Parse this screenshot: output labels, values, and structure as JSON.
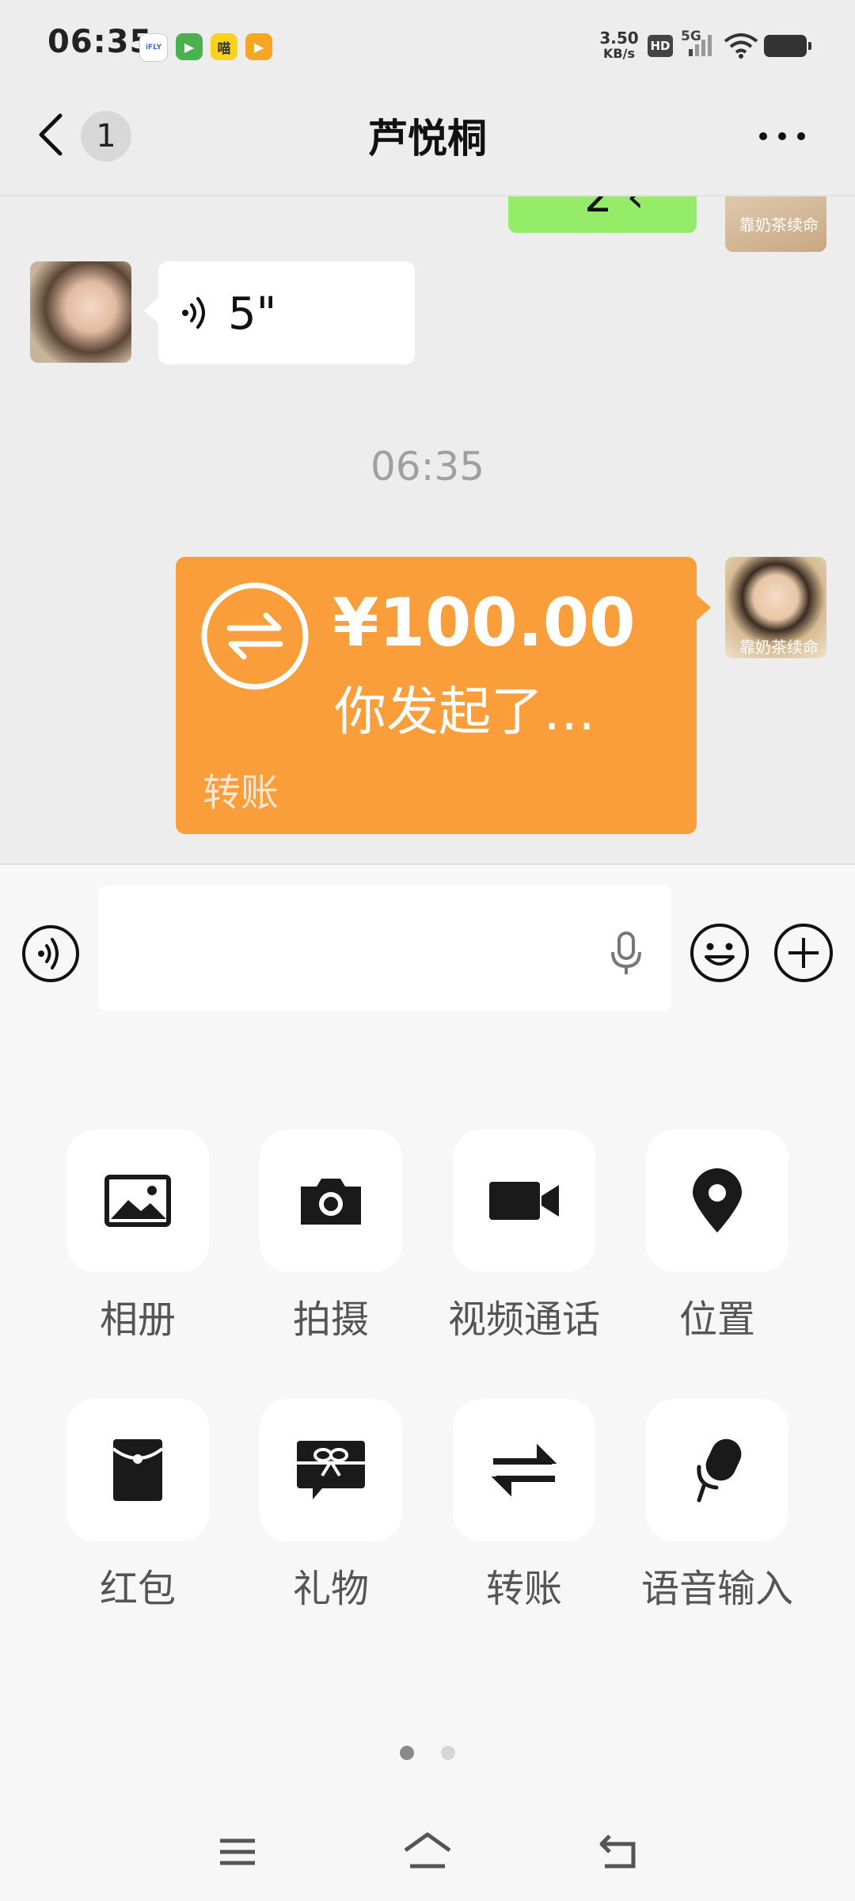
{
  "status_bar": {
    "time": "06:35",
    "net_speed_value": "3.50",
    "net_speed_unit": "KB/s",
    "hd_badge": "HD",
    "network": "5G",
    "app_badges": [
      {
        "name": "iflytek-app-icon",
        "color": "#ffffff",
        "text": "iFLY"
      },
      {
        "name": "video-app-icon",
        "color": "#4caf50",
        "text": "▶"
      },
      {
        "name": "yellow-app-icon",
        "color": "#f7d31c",
        "text": "喵"
      },
      {
        "name": "player-app-icon",
        "color": "#f5a623",
        "text": "▶"
      }
    ]
  },
  "header": {
    "back_icon": "chevron-left-icon",
    "unread_count": "1",
    "title": "芦悦桐",
    "more_icon": "more-dots-icon"
  },
  "chat": {
    "avatar_overlay_text": "靠奶茶续命",
    "voice_message": {
      "duration": "5\""
    },
    "time_divider": "06:35",
    "transfer": {
      "amount": "¥100.00",
      "status": "你发起了…",
      "label": "转账"
    }
  },
  "input_bar": {
    "message_value": "",
    "placeholder": ""
  },
  "panel": {
    "items": [
      {
        "label": "相册",
        "icon": "photo-album-icon"
      },
      {
        "label": "拍摄",
        "icon": "camera-icon"
      },
      {
        "label": "视频通话",
        "icon": "video-call-icon"
      },
      {
        "label": "位置",
        "icon": "location-pin-icon"
      },
      {
        "label": "红包",
        "icon": "red-packet-icon"
      },
      {
        "label": "礼物",
        "icon": "gift-icon"
      },
      {
        "label": "转账",
        "icon": "transfer-icon"
      },
      {
        "label": "语音输入",
        "icon": "voice-input-icon"
      }
    ],
    "page_indicator": {
      "current": 1,
      "total": 2
    }
  },
  "nav_bar": {
    "menu_icon": "menu-icon",
    "home_icon": "home-icon",
    "back_icon": "back-icon"
  },
  "colors": {
    "chat_bg": "#ededed",
    "panel_bg": "#f7f7f7",
    "transfer_orange": "#fa9d3b",
    "sent_green": "#95ec69"
  }
}
